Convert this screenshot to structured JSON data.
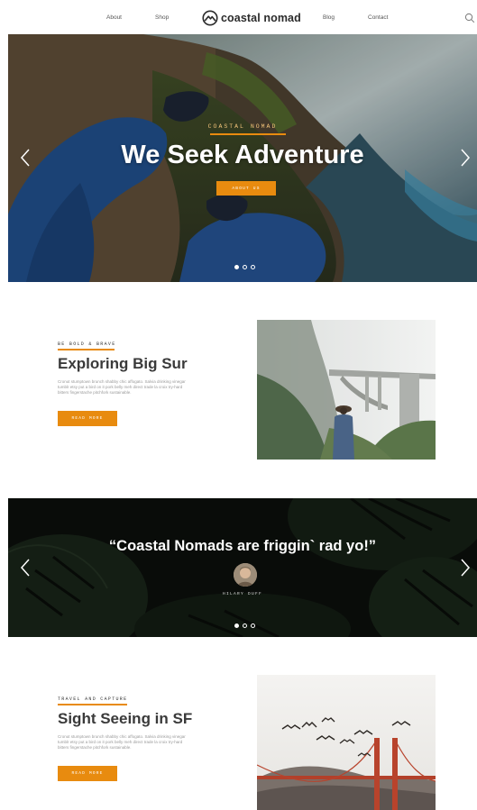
{
  "nav": {
    "about": "About",
    "shop": "Shop",
    "logo_text": "coastal nomad",
    "blog": "Blog",
    "contact": "Contact"
  },
  "hero": {
    "eyebrow": "COASTAL NOMAD",
    "title": "We Seek Adventure",
    "button": "ABOUT US",
    "slides": 3,
    "active_slide": 1
  },
  "feature1": {
    "kicker": "BE BOLD & BRAVE",
    "title": "Exploring Big Sur",
    "text": "Cronut stumptown brunch shabby chic affogato. Salvia drinking vinegar tumblr etsy put a bird on it pork belly meh direct trade la croix try-hard bitters fingerstache pitchfork sustainable.",
    "button": "READ MORE"
  },
  "testimonial": {
    "quote": "“Coastal Nomads are friggin` rad yo!”",
    "author": "HILARY DUFF",
    "slides": 3,
    "active_slide": 1
  },
  "feature2": {
    "kicker": "TRAVEL AND CAPTURE",
    "title": "Sight Seeing in SF",
    "text": "Cronut stumptown brunch shabby chic affogato. Salvia drinking vinegar tumblr etsy put a bird on it pork belly meh direct trade la croix try-hard bitters fingerstache pitchfork sustainable.",
    "button": "READ MORE"
  },
  "colors": {
    "accent": "#e88b0f",
    "heading": "#3a3a3a",
    "body_text": "#9a9a9a"
  },
  "icons": [
    "mountain-logo-icon",
    "search-icon",
    "chevron-left-icon",
    "chevron-right-icon"
  ]
}
